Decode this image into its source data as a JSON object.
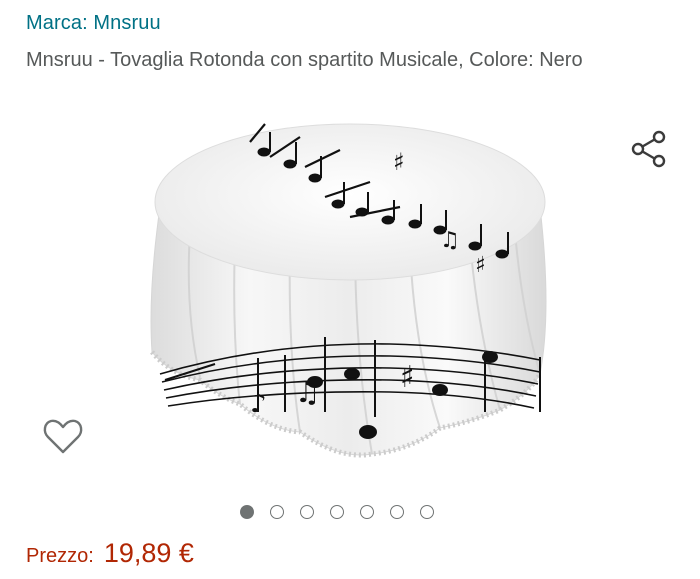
{
  "product": {
    "brand_label": "Marca: Mnsruu",
    "title": "Mnsruu - Tovaglia Rotonda con spartito Musicale, Colore: Nero",
    "image_icon": "round-tablecloth-music-notes-image",
    "carousel": {
      "total": 7,
      "active": 1
    }
  },
  "price": {
    "label": "Prezzo:",
    "value": "19,89 €"
  },
  "icons": {
    "share": "share-icon",
    "wishlist": "heart-outline-icon"
  },
  "colors": {
    "brand_link": "#007185",
    "price": "#B12704",
    "text_muted": "#565959",
    "icon_gray": "#6F7373"
  }
}
